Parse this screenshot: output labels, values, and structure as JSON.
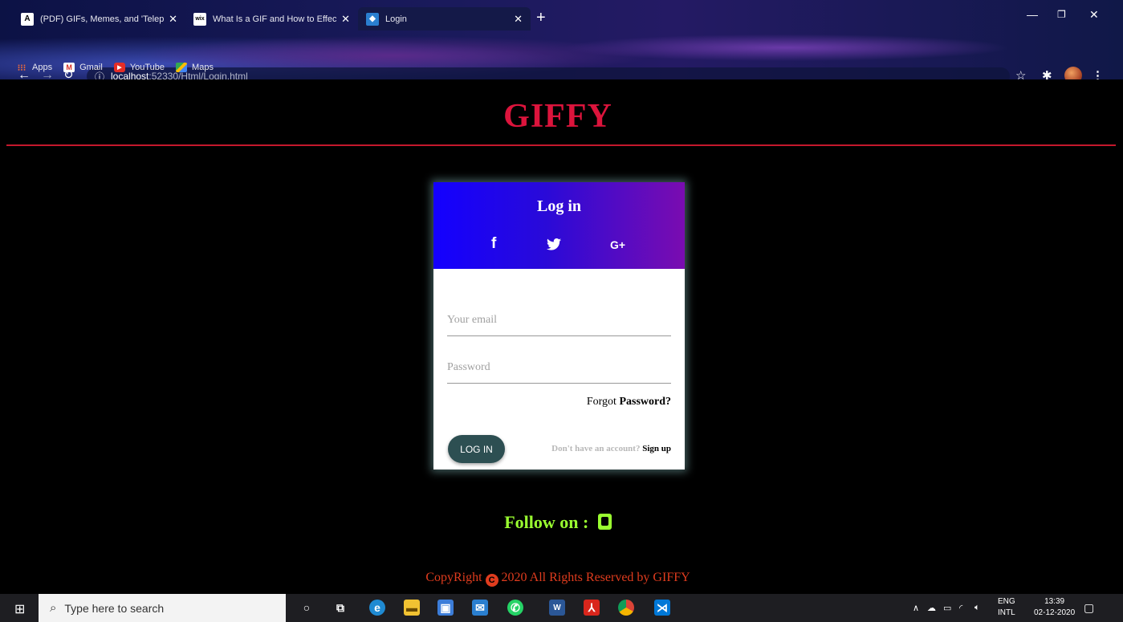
{
  "browser": {
    "tabs": [
      {
        "title": "(PDF) GIFs, Memes, and 'Telephili",
        "favicon": "A"
      },
      {
        "title": "What Is a GIF and How to Effecti",
        "favicon": "wix"
      },
      {
        "title": "Login",
        "favicon": ""
      }
    ],
    "url": {
      "host": "localhost",
      "path": ":52330/Html/Login.html"
    },
    "bookmarks": [
      {
        "label": "Apps"
      },
      {
        "label": "Gmail"
      },
      {
        "label": "YouTube"
      },
      {
        "label": "Maps"
      }
    ]
  },
  "page": {
    "brand": "GIFFY",
    "card": {
      "title": "Log in",
      "social": {
        "facebook": "f",
        "google": "G+"
      },
      "email_placeholder": "Your email",
      "password_placeholder": "Password",
      "forgot_prefix": "Forgot ",
      "forgot_bold": "Password?",
      "login_button": "LOG IN",
      "signup_prompt": "Don't have an account? ",
      "signup_link": "Sign up"
    },
    "follow": "Follow on :",
    "copyright_prefix": "CopyRight ",
    "copyright_symbol": "C",
    "copyright_text": " 2020 All Rights Reserved by GIFFY"
  },
  "taskbar": {
    "search_placeholder": "Type here to search",
    "lang_top": "ENG",
    "lang_bottom": "INTL",
    "time": "13:39",
    "date": "02-12-2020"
  },
  "colors": {
    "brand": "#dc143c",
    "follow": "#9aff30",
    "copyright": "#e03c1e",
    "login_button": "#2d4f52",
    "header_gradient_start": "#1300ff",
    "header_gradient_end": "#7a0cb0"
  }
}
